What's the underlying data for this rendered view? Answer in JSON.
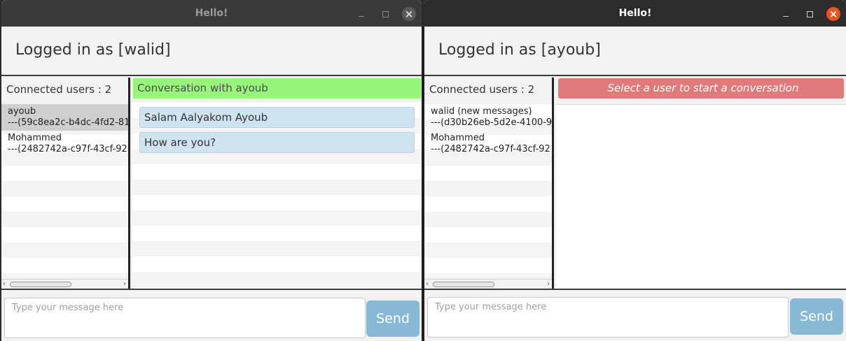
{
  "windows": [
    {
      "title": "Hello!",
      "logged_in": "Logged in as [walid]",
      "connected_users": "Connected users : 2",
      "users": [
        {
          "name": "ayoub",
          "id": "---(59c8ea2c-b4dc-4fd2-81",
          "selected": true
        },
        {
          "name": "Mohammed",
          "id": "---(2482742a-c97f-43cf-92",
          "selected": false
        }
      ],
      "conversation_title": "Conversation with ayoub",
      "messages": [
        "Salam Aalyakom Ayoub",
        "How are you?"
      ],
      "input_placeholder": "Type your message here",
      "send_label": "Send"
    },
    {
      "title": "Hello!",
      "logged_in": "Logged in as [ayoub]",
      "connected_users": "Connected users : 2",
      "users": [
        {
          "name": "walid (new messages)",
          "id": "---(d30b26eb-5d2e-4100-9",
          "selected": false
        },
        {
          "name": "Mohammed",
          "id": "---(2482742a-c97f-43cf-92",
          "selected": false
        }
      ],
      "conversation_title": "Select a user to start a conversation",
      "messages": [],
      "input_placeholder": "Type your message here",
      "send_label": "Send"
    }
  ],
  "colors": {
    "conversation_active": "#98f57c",
    "conversation_empty": "#e07a7a",
    "message_bubble": "#d0e3f1",
    "send_button": "#87b9d6",
    "close_active": "#e95420"
  },
  "icons": [
    "minimize-icon",
    "maximize-icon",
    "close-icon",
    "scroll-left-icon",
    "scroll-right-icon"
  ]
}
